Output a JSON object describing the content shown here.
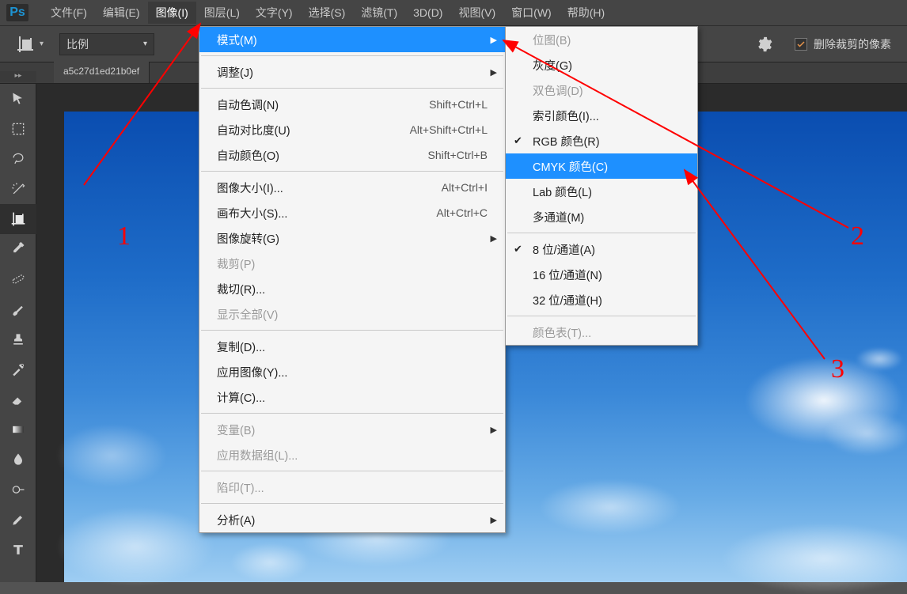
{
  "app": {
    "logo": "Ps"
  },
  "menubar": [
    "文件(F)",
    "编辑(E)",
    "图像(I)",
    "图层(L)",
    "文字(Y)",
    "选择(S)",
    "滤镜(T)",
    "3D(D)",
    "视图(V)",
    "窗口(W)",
    "帮助(H)"
  ],
  "menubar_active_index": 2,
  "optionsbar": {
    "ratio_label": "比例",
    "checkbox_checked": true,
    "checkbox_label": "删除裁剪的像素"
  },
  "document_tab": "a5c27d1ed21b0ef",
  "dropdown": {
    "groups": [
      [
        {
          "label": "模式(M)",
          "hl": true,
          "arrow": true
        }
      ],
      [
        {
          "label": "调整(J)",
          "arrow": true
        }
      ],
      [
        {
          "label": "自动色调(N)",
          "shortcut": "Shift+Ctrl+L"
        },
        {
          "label": "自动对比度(U)",
          "shortcut": "Alt+Shift+Ctrl+L"
        },
        {
          "label": "自动颜色(O)",
          "shortcut": "Shift+Ctrl+B"
        }
      ],
      [
        {
          "label": "图像大小(I)...",
          "shortcut": "Alt+Ctrl+I"
        },
        {
          "label": "画布大小(S)...",
          "shortcut": "Alt+Ctrl+C"
        },
        {
          "label": "图像旋转(G)",
          "arrow": true
        },
        {
          "label": "裁剪(P)",
          "disabled": true
        },
        {
          "label": "裁切(R)..."
        },
        {
          "label": "显示全部(V)",
          "disabled": true
        }
      ],
      [
        {
          "label": "复制(D)..."
        },
        {
          "label": "应用图像(Y)..."
        },
        {
          "label": "计算(C)..."
        }
      ],
      [
        {
          "label": "变量(B)",
          "disabled": true,
          "arrow": true
        },
        {
          "label": "应用数据组(L)...",
          "disabled": true
        }
      ],
      [
        {
          "label": "陷印(T)...",
          "disabled": true
        }
      ],
      [
        {
          "label": "分析(A)",
          "arrow": true
        }
      ]
    ]
  },
  "submenu": {
    "groups": [
      [
        {
          "label": "位图(B)",
          "disabled": true
        },
        {
          "label": "灰度(G)"
        },
        {
          "label": "双色调(D)",
          "disabled": true
        },
        {
          "label": "索引颜色(I)..."
        },
        {
          "label": "RGB 颜色(R)",
          "checked": true
        },
        {
          "label": "CMYK 颜色(C)",
          "hl": true
        },
        {
          "label": "Lab 颜色(L)"
        },
        {
          "label": "多通道(M)"
        }
      ],
      [
        {
          "label": "8 位/通道(A)",
          "checked": true
        },
        {
          "label": "16 位/通道(N)"
        },
        {
          "label": "32 位/通道(H)"
        }
      ],
      [
        {
          "label": "颜色表(T)...",
          "disabled": true
        }
      ]
    ]
  },
  "annotations": {
    "n1": "1",
    "n2": "2",
    "n3": "3"
  },
  "tool_icons": [
    "move",
    "marquee",
    "lasso",
    "wand",
    "crop",
    "eyedrop",
    "heal",
    "brush",
    "stamp",
    "history",
    "eraser",
    "gradient",
    "blur",
    "dodge",
    "pen",
    "type"
  ]
}
